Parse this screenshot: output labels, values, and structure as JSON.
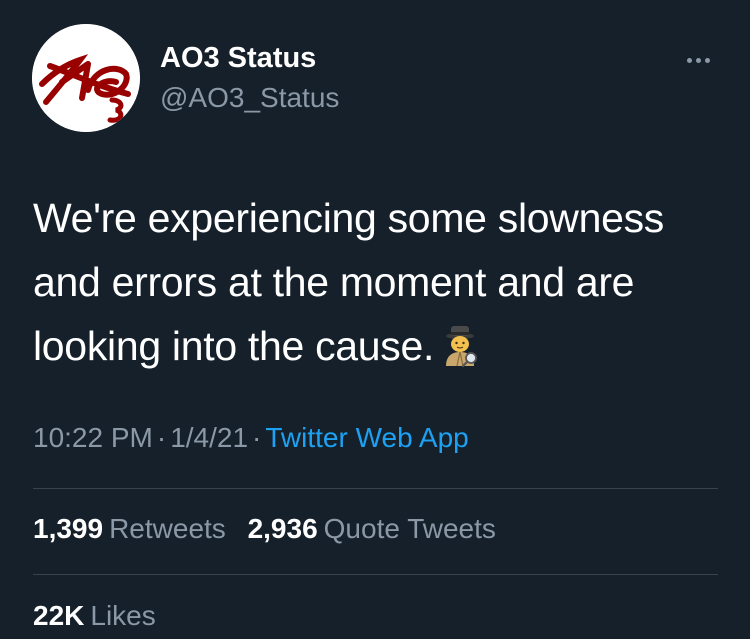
{
  "account": {
    "display_name": "AO3 Status",
    "handle": "@AO3_Status",
    "avatar_icon": "ao3-logo"
  },
  "more_icon": "more-horizontal-icon",
  "tweet": {
    "text": "We're experiencing some slowness and errors at the moment and are looking into the cause.",
    "emoji_icon": "detective-emoji"
  },
  "meta": {
    "time": "10:22 PM",
    "separator": "·",
    "date": "1/4/21",
    "source": "Twitter Web App"
  },
  "stats": {
    "retweets_count": "1,399",
    "retweets_label": "Retweets",
    "quotes_count": "2,936",
    "quotes_label": "Quote Tweets",
    "likes_count": "22K",
    "likes_label": "Likes"
  },
  "colors": {
    "background": "#15202b",
    "primary_text": "#ffffff",
    "secondary_text": "#8b98a5",
    "link": "#1da1f2",
    "divider": "#38444d",
    "logo_red": "#990000"
  }
}
